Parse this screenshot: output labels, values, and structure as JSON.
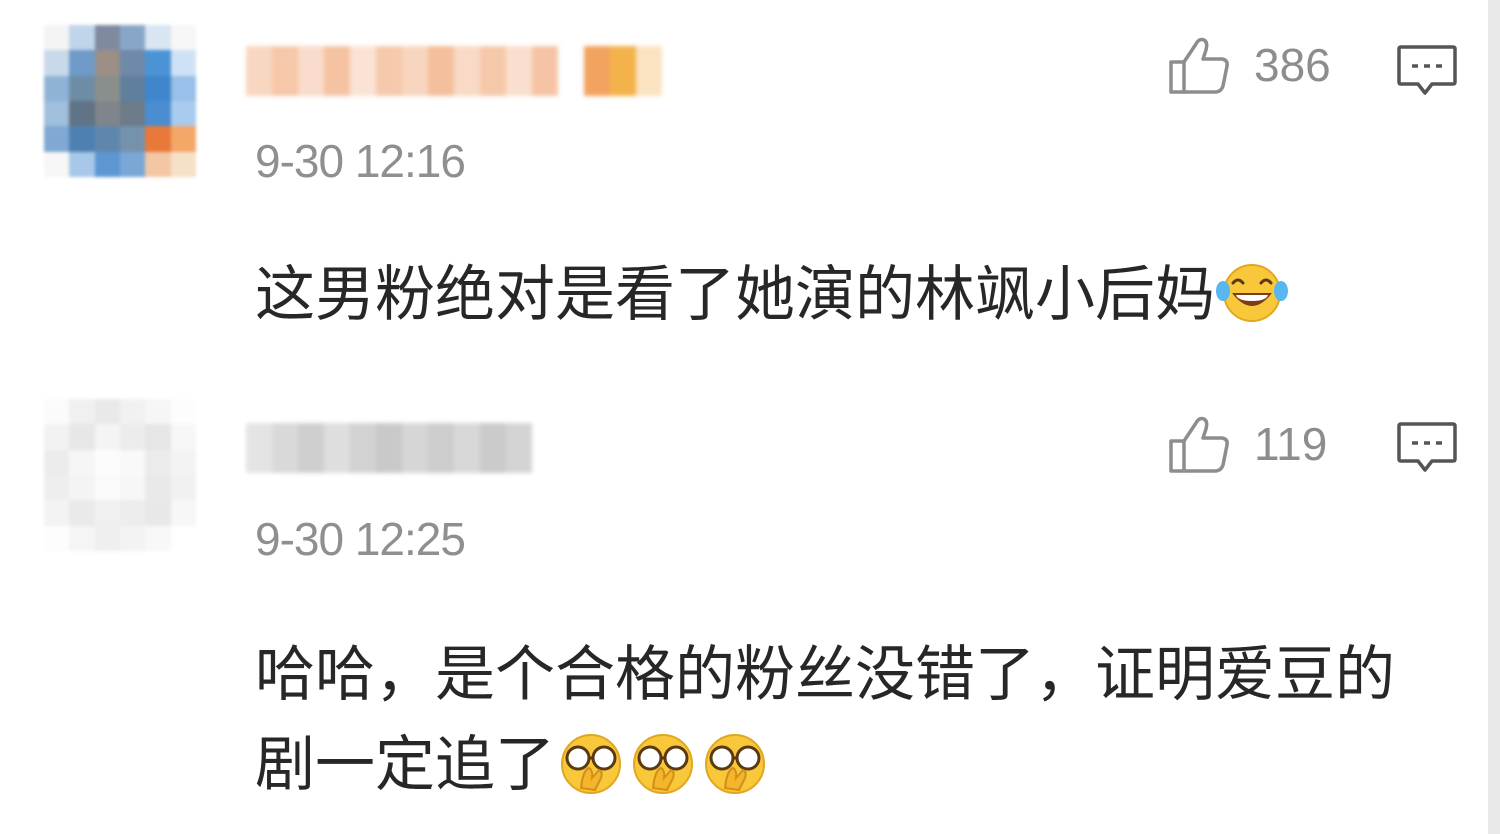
{
  "comments": [
    {
      "time": "9-30 12:16",
      "likes": "386",
      "text": "这男粉绝对是看了她演的林飒小后妈",
      "emojis": [
        "laughing-tears-emoji"
      ]
    },
    {
      "time": "9-30 12:25",
      "likes": "119",
      "text": "哈哈，是个合格的粉丝没错了，证明爱豆的剧一定追了",
      "emojis": [
        "peeking-glasses-emoji",
        "peeking-glasses-emoji",
        "peeking-glasses-emoji"
      ]
    }
  ],
  "icons": {
    "like": "thumbs-up-outline-icon",
    "reply": "comment-bubble-icon"
  },
  "colors": {
    "text": "#272727",
    "meta": "#8f8f8f",
    "background": "#ffffff"
  }
}
